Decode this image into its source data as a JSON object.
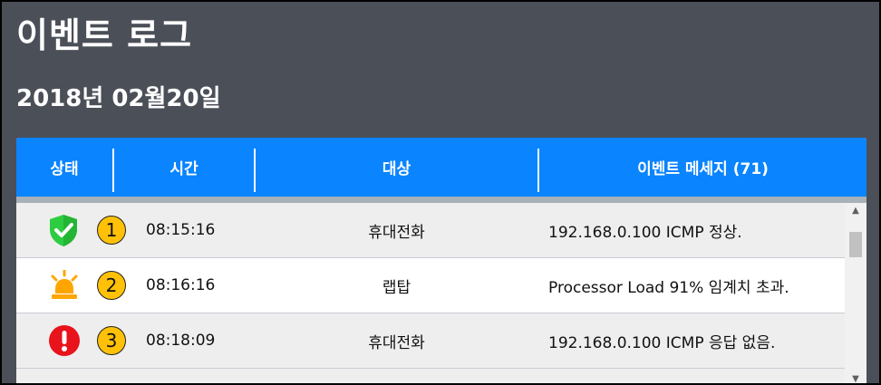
{
  "page": {
    "title": "이벤트 로그",
    "date": "2018년 02월20일"
  },
  "table": {
    "headers": {
      "status": "상태",
      "time": "시간",
      "target": "대상",
      "message": "이벤트 메세지 (71)"
    },
    "rows": [
      {
        "status_icon": "shield-check-icon",
        "number": "1",
        "time": "08:15:16",
        "target": "휴대전화",
        "message": "192.168.0.100 ICMP 정상."
      },
      {
        "status_icon": "alarm-light-icon",
        "number": "2",
        "time": "08:16:16",
        "target": "랩탑",
        "message": "Processor Load 91% 임계치 초과."
      },
      {
        "status_icon": "error-exclamation-icon",
        "number": "3",
        "time": "08:18:09",
        "target": "휴대전화",
        "message": "192.168.0.100 ICMP 응답 없음."
      }
    ]
  },
  "colors": {
    "background": "#4b4f58",
    "header": "#0a84ff",
    "ok": "#2ecc40",
    "warning": "#ffa500",
    "error": "#e8131b",
    "badge": "#ffc107"
  }
}
